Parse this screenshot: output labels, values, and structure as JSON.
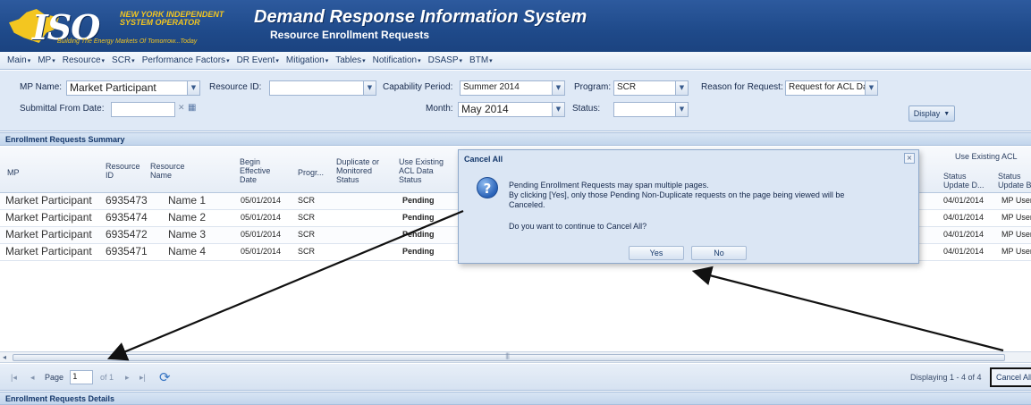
{
  "header": {
    "logo_main": "ISO",
    "logo_sub": "NEW YORK INDEPENDENT SYSTEM OPERATOR",
    "logo_tagline": "Building The Energy Markets Of Tomorrow...Today",
    "title": "Demand Response Information System",
    "subtitle": "Resource Enrollment Requests"
  },
  "menu": {
    "items": [
      {
        "label": "Main",
        "caret": "▾"
      },
      {
        "label": "MP",
        "caret": "▾"
      },
      {
        "label": "Resource",
        "caret": "▾"
      },
      {
        "label": "SCR",
        "caret": "▾"
      },
      {
        "label": "Performance Factors",
        "caret": "▾"
      },
      {
        "label": "DR Event",
        "caret": "▾"
      },
      {
        "label": "Mitigation",
        "caret": "▾"
      },
      {
        "label": "Tables",
        "caret": "▾"
      },
      {
        "label": "Notification",
        "caret": "▾"
      },
      {
        "label": "DSASP",
        "caret": "▾"
      },
      {
        "label": "BTM",
        "caret": "▾"
      }
    ]
  },
  "filters": {
    "mp_name_label": "MP Name:",
    "mp_name_value": "Market Participant",
    "resource_id_label": "Resource ID:",
    "resource_id_value": "",
    "capability_period_label": "Capability Period:",
    "capability_period_value": "Summer 2014",
    "program_label": "Program:",
    "program_value": "SCR",
    "reason_label": "Reason for Request:",
    "reason_value": "Request for ACL Da",
    "submittal_from_label": "Submittal From Date:",
    "submittal_from_value": "",
    "month_label": "Month:",
    "month_value": "May 2014",
    "status_label": "Status:",
    "status_value": "",
    "display_button": "Display"
  },
  "summary": {
    "title": "Enrollment Requests Summary",
    "columns": {
      "mp": "MP",
      "resource_id": "Resource ID",
      "resource_name": "Resource Name",
      "begin_date": "Begin Effective Date",
      "program": "Progr...",
      "dup_status": "Duplicate or Monitored Status",
      "acl_status": "Use Existing ACL Data Status",
      "group_right": "Use Existing ACL",
      "status_update_date": "Status Update D...",
      "status_update_by": "Status Update B"
    },
    "rows": [
      {
        "mp": "Market Participant",
        "resource_id": "6935473",
        "resource_name": "Name 1",
        "begin_date": "05/01/2014",
        "program": "SCR",
        "acl_status": "Pending",
        "update_date": "04/01/2014",
        "update_by": "MP User"
      },
      {
        "mp": "Market Participant",
        "resource_id": "6935474",
        "resource_name": "Name 2",
        "begin_date": "05/01/2014",
        "program": "SCR",
        "acl_status": "Pending",
        "update_date": "04/01/2014",
        "update_by": "MP User"
      },
      {
        "mp": "Market Participant",
        "resource_id": "6935472",
        "resource_name": "Name 3",
        "begin_date": "05/01/2014",
        "program": "SCR",
        "acl_status": "Pending",
        "update_date": "04/01/2014",
        "update_by": "MP User"
      },
      {
        "mp": "Market Participant",
        "resource_id": "6935471",
        "resource_name": "Name 4",
        "begin_date": "05/01/2014",
        "program": "SCR",
        "acl_status": "Pending",
        "update_date": "04/01/2014",
        "update_by": "MP User"
      }
    ]
  },
  "pager": {
    "page_label": "Page",
    "page_value": "1",
    "of_label": "of 1",
    "displaying": "Displaying 1 - 4 of 4",
    "cancel_all": "Cancel All"
  },
  "details": {
    "title": "Enrollment Requests Details"
  },
  "dialog": {
    "title": "Cancel All",
    "line1": "Pending Enrollment Requests may span multiple pages.",
    "line2": "By clicking [Yes], only those Pending Non-Duplicate requests on the page being viewed will be",
    "line3": "Canceled.",
    "question": "Do you want to continue to Cancel All?",
    "yes": "Yes",
    "no": "No",
    "close": "×"
  },
  "colors": {
    "header_blue": "#1f4a8a",
    "logo_gold": "#f3c620",
    "panel_bg": "#dfe9f6",
    "arrow": "#111111"
  }
}
